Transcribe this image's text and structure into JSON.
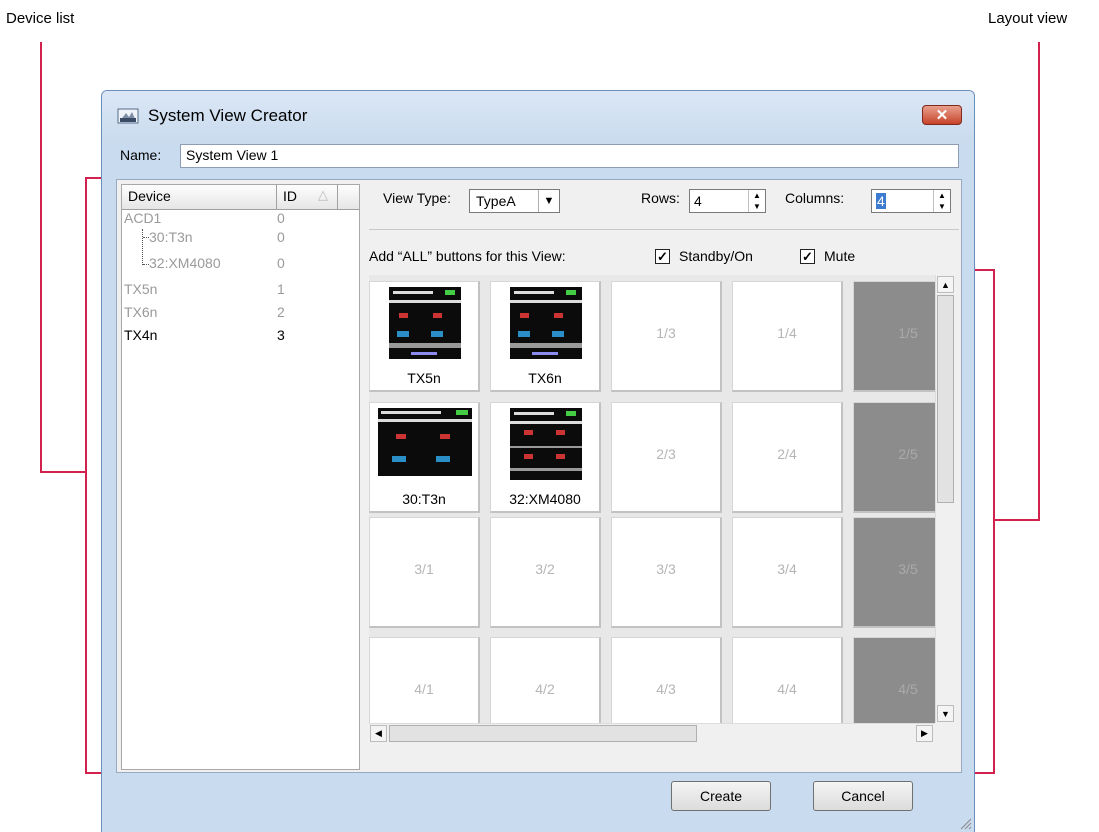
{
  "callouts": {
    "device_list": "Device list",
    "layout_view": "Layout view"
  },
  "window": {
    "title": "System View Creator",
    "close_label": "✕"
  },
  "name": {
    "label": "Name:",
    "value": "System View 1"
  },
  "device_list": {
    "columns": {
      "device": "Device",
      "id": "ID"
    },
    "rows": [
      {
        "name": "ACD1",
        "id": "0"
      },
      {
        "name": "30:T3n",
        "id": "0"
      },
      {
        "name": "32:XM4080",
        "id": "0"
      },
      {
        "name": "TX5n",
        "id": "1"
      },
      {
        "name": "TX6n",
        "id": "2"
      },
      {
        "name": "TX4n",
        "id": "3"
      }
    ]
  },
  "view_type": {
    "label": "View Type:",
    "value": "TypeA"
  },
  "rows": {
    "label": "Rows:",
    "value": "4"
  },
  "columns": {
    "label": "Columns:",
    "value": "4"
  },
  "all_buttons": {
    "label": "Add “ALL” buttons for this View:",
    "standby_label": "Standby/On",
    "mute_label": "Mute",
    "standby_checked": true,
    "mute_checked": true
  },
  "grid": {
    "r1": {
      "c1": "TX5n",
      "c2": "TX6n",
      "c3": "1/3",
      "c4": "1/4",
      "c5": "1/5"
    },
    "r2": {
      "c1": "30:T3n",
      "c2": "32:XM4080",
      "c3": "2/3",
      "c4": "2/4",
      "c5": "2/5"
    },
    "r3": {
      "c1": "3/1",
      "c2": "3/2",
      "c3": "3/3",
      "c4": "3/4",
      "c5": "3/5"
    },
    "r4": {
      "c1": "4/1",
      "c2": "4/2",
      "c3": "4/3",
      "c4": "4/4",
      "c5": "4/5"
    }
  },
  "buttons": {
    "create": "Create",
    "cancel": "Cancel"
  },
  "colors": {
    "callout_line": "#d3214d",
    "title_bar": "#c9dbee",
    "disabled_cell": "#8c8c8c"
  }
}
